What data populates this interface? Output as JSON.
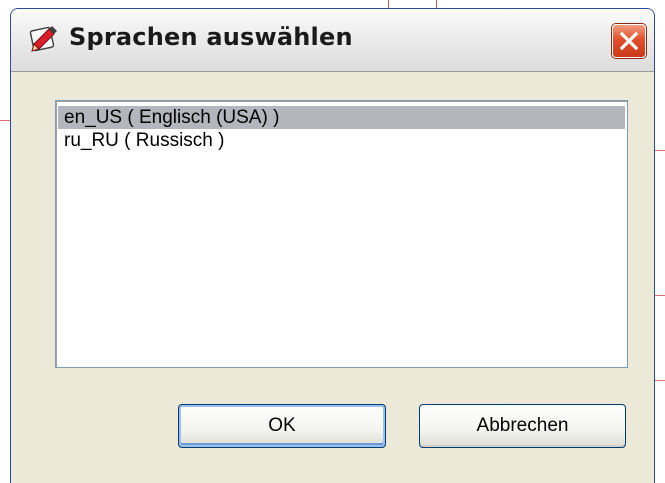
{
  "window": {
    "title": "Sprachen auswählen",
    "icon": "app-pen-icon",
    "close_icon": "close-icon"
  },
  "language_list": {
    "items": [
      {
        "label": "en_US ( Englisch (USA) )",
        "selected": true
      },
      {
        "label": "ru_RU ( Russisch )",
        "selected": false
      }
    ]
  },
  "buttons": {
    "ok_label": "OK",
    "cancel_label": "Abbrechen"
  },
  "colors": {
    "selection": "#b5b5bd",
    "close_button": "#e0502e",
    "window_background": "#ece9d8"
  }
}
